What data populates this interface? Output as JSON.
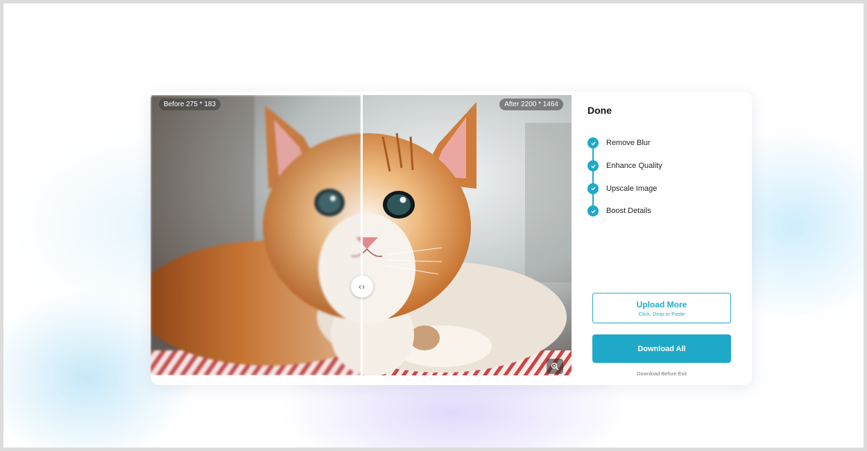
{
  "comparison": {
    "before_label": "Before 275 * 183",
    "after_label": "After 2200 * 1464",
    "handle_glyph": "‹›"
  },
  "panel": {
    "status": "Done",
    "steps": [
      {
        "label": "Remove Blur"
      },
      {
        "label": "Enhance Quality"
      },
      {
        "label": "Upscale Image"
      },
      {
        "label": "Boost Details"
      }
    ],
    "upload": {
      "label": "Upload More",
      "sublabel": "Click, Drop or Paste"
    },
    "download": {
      "label": "Download All",
      "note": "Download Before Exit"
    }
  },
  "colors": {
    "accent": "#1fa9c9",
    "card_bg": "#ffffff"
  },
  "icons": [
    "check-icon",
    "compare-handle-icon",
    "zoom-in-icon"
  ]
}
